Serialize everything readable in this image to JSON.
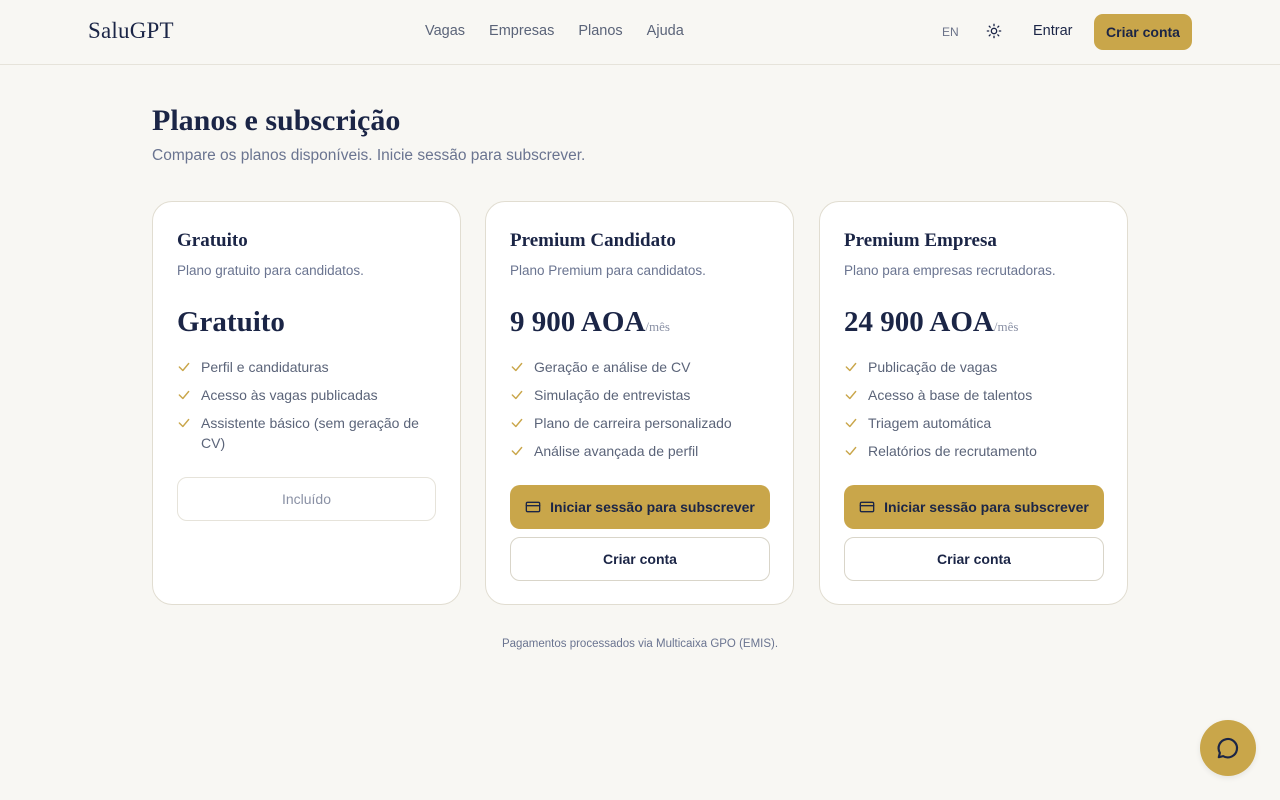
{
  "header": {
    "logo": "SaluGPT",
    "nav": [
      "Vagas",
      "Empresas",
      "Planos",
      "Ajuda"
    ],
    "lang": "EN",
    "theme_icon": "sun-icon",
    "login": "Entrar",
    "signup": "Criar conta"
  },
  "page": {
    "title": "Planos e subscrição",
    "subtitle": "Compare os planos disponíveis. Inicie sessão para subscrever."
  },
  "plans": [
    {
      "name": "Gratuito",
      "description": "Plano gratuito para candidatos.",
      "price": "Gratuito",
      "period": "",
      "features": [
        "Perfil e candidaturas",
        "Acesso às vagas publicadas",
        "Assistente básico (sem geração de CV)"
      ],
      "included_label": "Incluído"
    },
    {
      "name": "Premium Candidato",
      "description": "Plano Premium para candidatos.",
      "price": "9 900 AOA",
      "period": "/mês",
      "features": [
        "Geração e análise de CV",
        "Simulação de entrevistas",
        "Plano de carreira personalizado",
        "Análise avançada de perfil"
      ],
      "subscribe_label": "Iniciar sessão para subscrever",
      "create_label": "Criar conta"
    },
    {
      "name": "Premium Empresa",
      "description": "Plano para empresas recrutadoras.",
      "price": "24 900 AOA",
      "period": "/mês",
      "features": [
        "Publicação de vagas",
        "Acesso à base de talentos",
        "Triagem automática",
        "Relatórios de recrutamento"
      ],
      "subscribe_label": "Iniciar sessão para subscrever",
      "create_label": "Criar conta"
    }
  ],
  "footer": {
    "payments_note": "Pagamentos processados via Multicaixa GPO (EMIS)."
  },
  "chat": {
    "icon": "chat-bubble-icon"
  },
  "colors": {
    "accent": "#c9a64a",
    "navy": "#1b2546",
    "background": "#f8f7f3"
  }
}
